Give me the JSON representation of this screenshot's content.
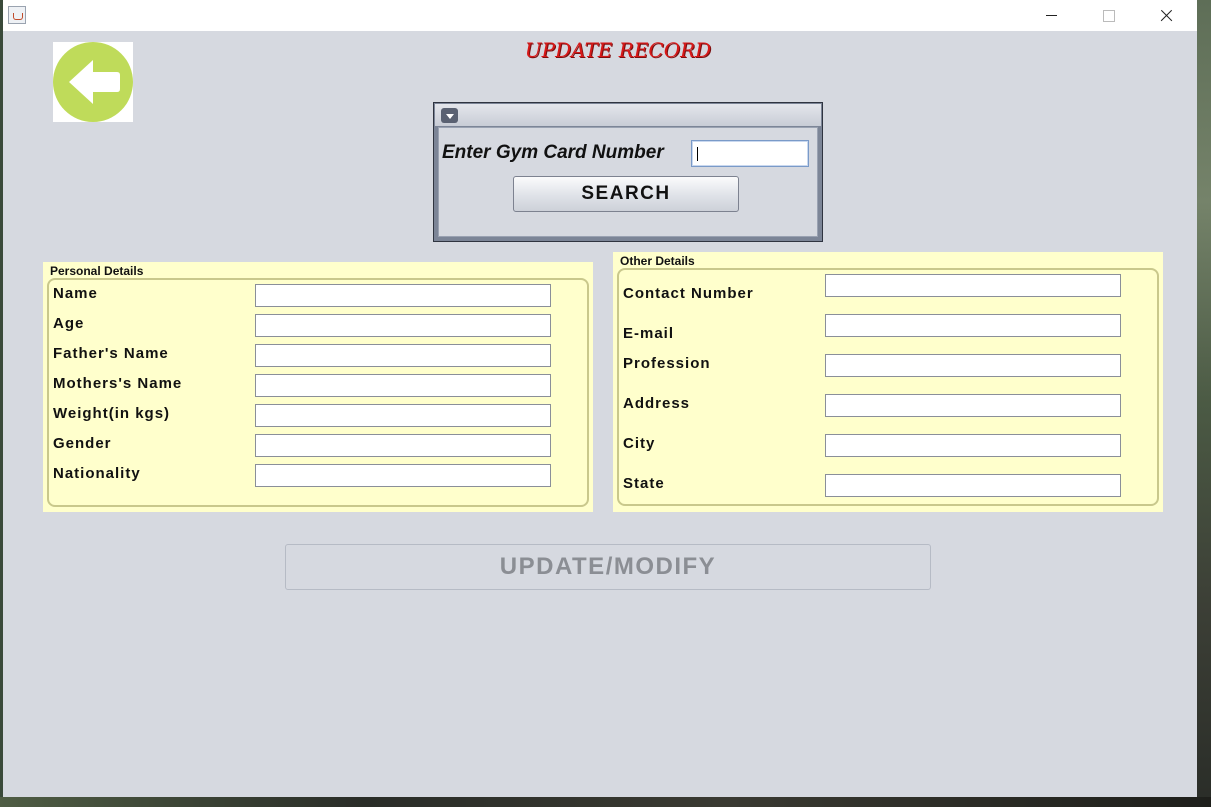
{
  "window": {
    "title": "",
    "controls": {
      "minimize": "minimize-icon",
      "maximize": "maximize-icon",
      "close": "close-icon"
    }
  },
  "page": {
    "title": "UPDATE RECORD",
    "back_icon": "arrow-left-icon"
  },
  "search": {
    "label": "Enter Gym Card Number",
    "value": "",
    "button_label": "SEARCH"
  },
  "personal_details": {
    "title": "Personal Details",
    "fields": [
      {
        "label": "Name",
        "value": ""
      },
      {
        "label": "Age",
        "value": ""
      },
      {
        "label": "Father's Name",
        "value": ""
      },
      {
        "label": "Mothers's Name",
        "value": ""
      },
      {
        "label": "Weight(in kgs)",
        "value": ""
      },
      {
        "label": "Gender",
        "value": ""
      },
      {
        "label": "Nationality",
        "value": ""
      }
    ]
  },
  "other_details": {
    "title": "Other Details",
    "fields": [
      {
        "label": "Contact Number",
        "value": ""
      },
      {
        "label": "E-mail",
        "value": ""
      },
      {
        "label": "Profession",
        "value": ""
      },
      {
        "label": "Address",
        "value": ""
      },
      {
        "label": "City",
        "value": ""
      },
      {
        "label": "State",
        "value": ""
      }
    ]
  },
  "update_button": {
    "label": "UPDATE/MODIFY",
    "enabled": false
  },
  "colors": {
    "window_bg": "#d6d9e0",
    "panel_bg": "#ffffcc",
    "title_red": "#d81818",
    "back_button_green": "#bfdb5a"
  }
}
